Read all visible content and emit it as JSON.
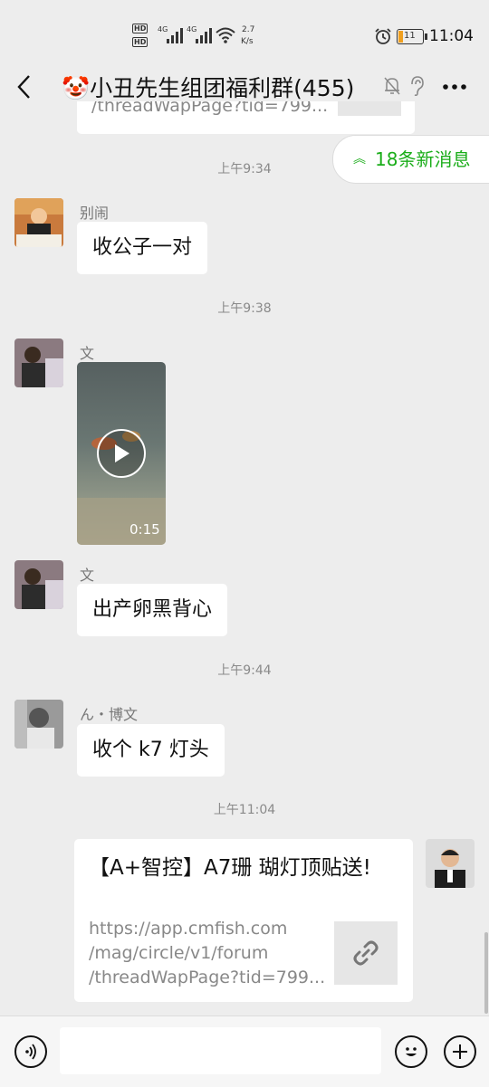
{
  "status_bar": {
    "hd1": "HD",
    "hd2": "HD",
    "net1": "4G",
    "net2": "4G",
    "speed_value": "2.7",
    "speed_unit": "K/s",
    "battery_level": "11",
    "time": "11:04"
  },
  "header": {
    "title": "🤡小丑先生组团福利群(455)"
  },
  "new_messages": {
    "label": "18条新消息"
  },
  "top_link_partial": "/threadWapPage?tid=799...",
  "messages": [
    {
      "timestamp": "上午9:34",
      "sender": "别闹",
      "text": "收公子一对"
    },
    {
      "timestamp": "上午9:38",
      "sender": "文",
      "video_duration": "0:15"
    },
    {
      "sender": "文",
      "text": "出产卵黑背心"
    },
    {
      "timestamp": "上午9:44",
      "sender": "ん・博文",
      "text": "收个 k7 灯头"
    },
    {
      "timestamp": "上午11:04",
      "link_title": "【A+智控】A7珊 瑚灯顶贴送!",
      "link_url_lines": [
        "https://app.cmfish.com",
        "/mag/circle/v1/forum",
        "/threadWapPage?tid=799..."
      ]
    }
  ],
  "colors": {
    "background": "#ededed",
    "accent_green": "#1aad19",
    "bubble": "#ffffff"
  }
}
